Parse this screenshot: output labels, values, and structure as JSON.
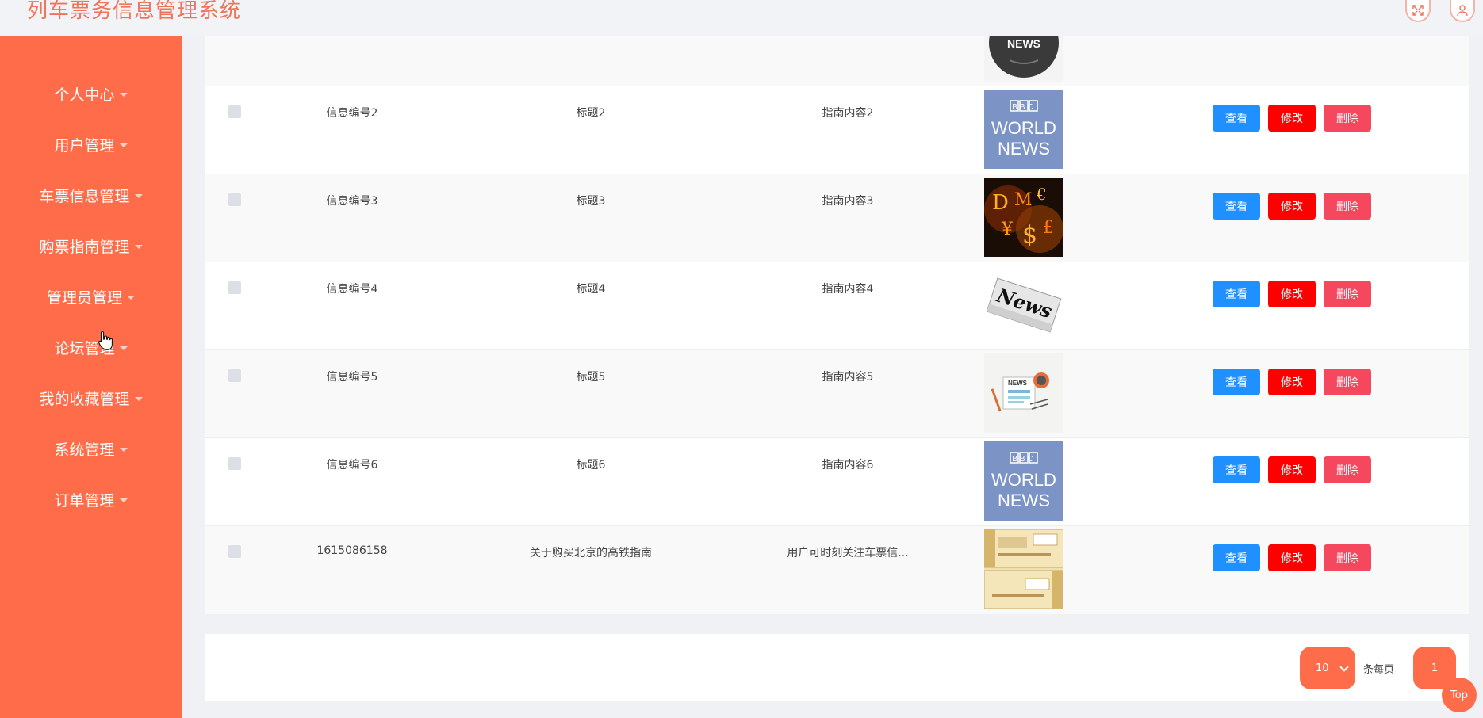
{
  "app": {
    "title": "列车票务信息管理系统"
  },
  "header": {
    "icons": [
      "fullscreen-icon",
      "user-icon"
    ]
  },
  "sidebar": {
    "items": [
      {
        "label": "个人中心"
      },
      {
        "label": "用户管理"
      },
      {
        "label": "车票信息管理"
      },
      {
        "label": "购票指南管理"
      },
      {
        "label": "管理员管理"
      },
      {
        "label": "论坛管理"
      },
      {
        "label": "我的收藏管理"
      },
      {
        "label": "系统管理"
      },
      {
        "label": "订单管理"
      }
    ]
  },
  "table": {
    "rows": [
      {
        "id": "信息编号2",
        "title": "标题2",
        "content": "指南内容2",
        "image": "bbc-world-news"
      },
      {
        "id": "信息编号3",
        "title": "标题3",
        "content": "指南内容3",
        "image": "currency-fire"
      },
      {
        "id": "信息编号4",
        "title": "标题4",
        "content": "指南内容4",
        "image": "news-paper"
      },
      {
        "id": "信息编号5",
        "title": "标题5",
        "content": "指南内容5",
        "image": "news-desk"
      },
      {
        "id": "信息编号6",
        "title": "标题6",
        "content": "指南内容6",
        "image": "bbc-world-news"
      },
      {
        "id": "1615086158",
        "title": "关于购买北京的高铁指南",
        "content": "用户可时刻关注车票信...",
        "image": "voucher"
      }
    ],
    "actions": {
      "view": "查看",
      "edit": "修改",
      "delete": "删除"
    }
  },
  "pagination": {
    "page_size": "10",
    "per_page_label": "条每页",
    "current_page": "1"
  },
  "back_to_top": "Top",
  "colors": {
    "primary": "#fe6c4a",
    "view": "#1e90ff",
    "edit": "#ff0000",
    "delete": "#f5475e"
  }
}
